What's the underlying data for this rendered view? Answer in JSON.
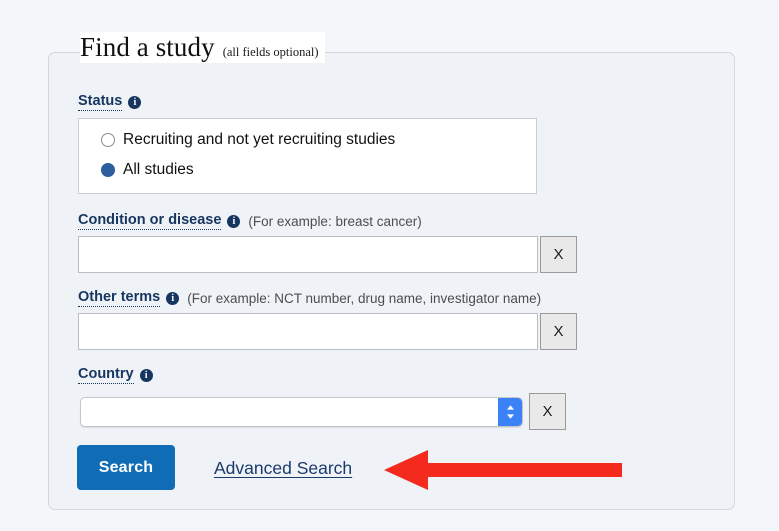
{
  "panel": {
    "title": "Find a study",
    "title_note": "(all fields optional)"
  },
  "status": {
    "label": "Status",
    "info_icon": "info-icon",
    "options": [
      {
        "label": "Recruiting and not yet recruiting studies",
        "selected": false
      },
      {
        "label": "All studies",
        "selected": true
      }
    ]
  },
  "condition": {
    "label": "Condition or disease",
    "info_icon": "info-icon",
    "hint": "(For example: breast cancer)",
    "value": "",
    "clear_label": "X"
  },
  "other_terms": {
    "label": "Other terms",
    "info_icon": "info-icon",
    "hint": "(For example: NCT number, drug name, investigator name)",
    "value": "",
    "clear_label": "X"
  },
  "country": {
    "label": "Country",
    "info_icon": "info-icon",
    "value": "",
    "stepper_icon": "chevron-up-down-icon",
    "clear_label": "X"
  },
  "actions": {
    "search_label": "Search",
    "advanced_search_label": "Advanced Search"
  },
  "annotation": {
    "arrow_icon": "left-arrow-icon",
    "arrow_color": "#f42a1e",
    "points_to": "Advanced Search"
  },
  "colors": {
    "page_background": "#f4f6fa",
    "panel_background": "#eff3f8",
    "panel_border": "#d3d8e0",
    "label_navy": "#16355f",
    "link_navy": "#1b3a6b",
    "button_blue": "#0f6cb5",
    "radio_selected_blue": "#2d5f9e",
    "stepper_blue": "#3b82f6",
    "annotation_red": "#f42a1e"
  }
}
